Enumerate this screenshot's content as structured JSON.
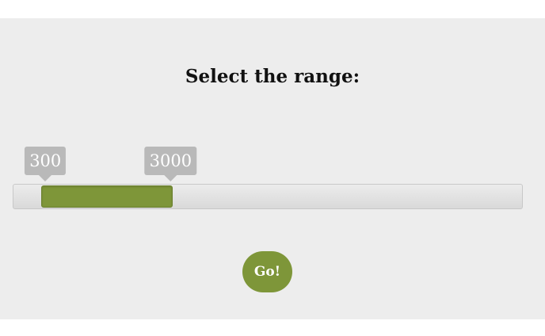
{
  "title": "Select the range:",
  "range": {
    "min": 0,
    "max": 10000,
    "low": 300,
    "high": 3000,
    "low_label": "300",
    "high_label": "3000"
  },
  "go_button": {
    "label": "Go!"
  },
  "colors": {
    "accent": "#7e9639",
    "tooltip": "#b9b9b9",
    "background": "#ededed"
  }
}
